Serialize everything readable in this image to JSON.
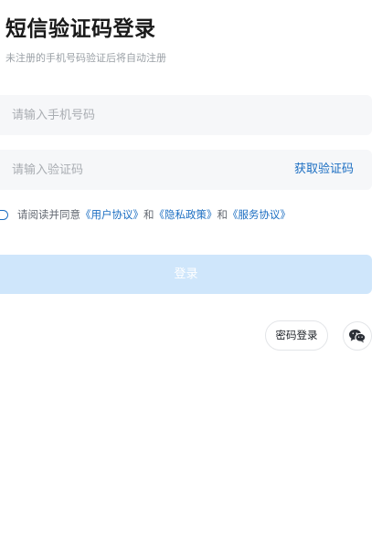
{
  "header": {
    "title": "短信验证码登录",
    "subtitle": "未注册的手机号码验证后将自动注册"
  },
  "form": {
    "phone_placeholder": "请输入手机号码",
    "code_placeholder": "请输入验证码",
    "get_code_label": "获取验证码"
  },
  "agreement": {
    "prefix": "请阅读并同意",
    "user_agreement": "《用户协议》",
    "and_1": "和",
    "privacy_policy": "《隐私政策》",
    "and_2": "和",
    "service_agreement": "《服务协议》",
    "checked": false
  },
  "actions": {
    "login_label": "登录",
    "password_login_label": "密码登录",
    "wechat_icon": "wechat-icon"
  },
  "colors": {
    "accent": "#1b6ec2",
    "button_disabled": "#cfe6fb",
    "input_bg": "#f6f7f9",
    "subtle_text": "#9aa0a6"
  }
}
